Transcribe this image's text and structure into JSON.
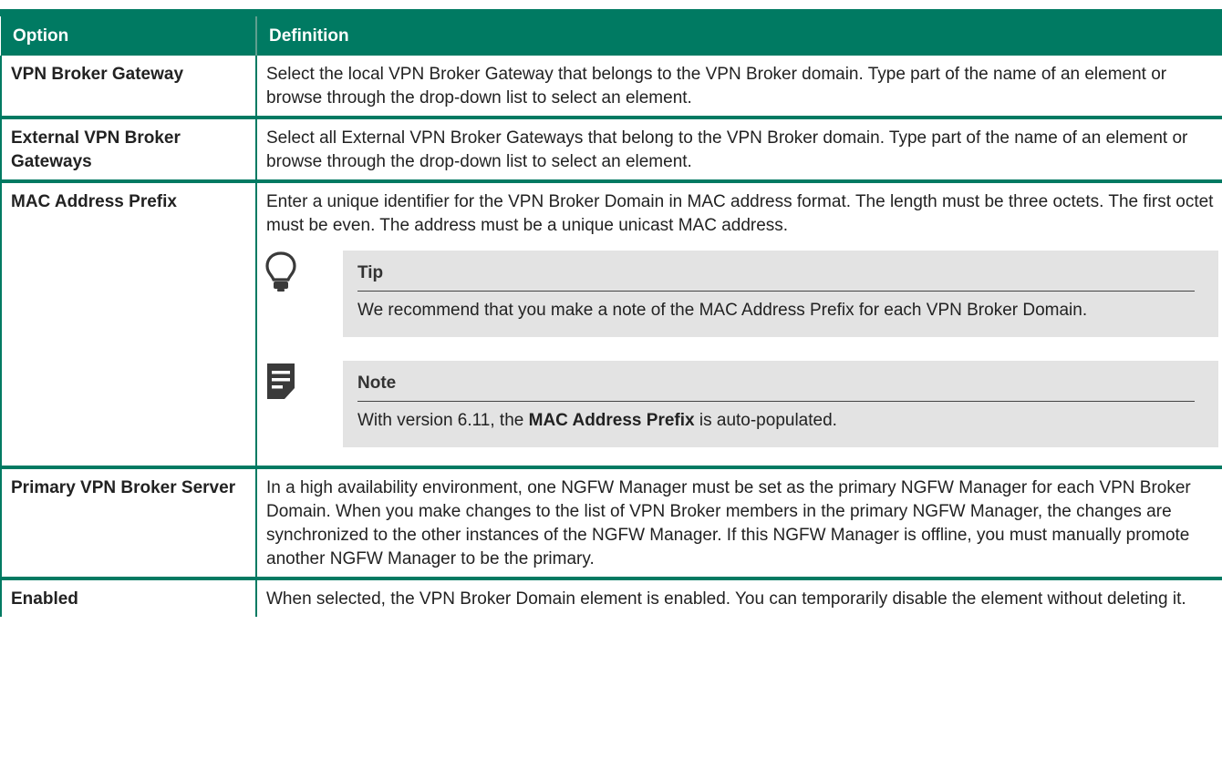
{
  "table": {
    "header": {
      "option": "Option",
      "definition": "Definition"
    },
    "rows": [
      {
        "option": "VPN Broker Gateway",
        "definition": "Select the local VPN Broker Gateway that belongs to the VPN Broker domain. Type part of the name of an element or browse through the drop-down list to select an element."
      },
      {
        "option": "External VPN Broker Gateways",
        "definition": "Select all External VPN Broker Gateways that belong to the VPN Broker domain. Type part of the name of an element or browse through the drop-down list to select an element."
      },
      {
        "option": "MAC Address Prefix",
        "definition": "Enter a unique identifier for the VPN Broker Domain in MAC address format. The length must be three octets. The first octet must be even. The address must be a unique unicast MAC address.",
        "tip": {
          "icon": "lightbulb-icon",
          "title": "Tip",
          "text": "We recommend that you make a note of the MAC Address Prefix for each VPN Broker Domain."
        },
        "note": {
          "icon": "note-icon",
          "title": "Note",
          "text_before": "With version 6.11, the ",
          "text_bold": "MAC Address Prefix",
          "text_after": " is auto-populated."
        }
      },
      {
        "option": "Primary VPN Broker Server",
        "definition": "In a high availability environment, one NGFW Manager must be set as the primary NGFW Manager for each VPN Broker Domain. When you make changes to the list of VPN Broker members in the primary NGFW Manager, the changes are synchronized to the other instances of the NGFW Manager. If this NGFW Manager is offline, you must manually promote another NGFW Manager to be the primary."
      },
      {
        "option": "Enabled",
        "definition": "When selected, the VPN Broker Domain element is enabled. You can temporarily disable the element without deleting it."
      }
    ]
  },
  "colors": {
    "header_bg": "#007a62",
    "header_text": "#ffffff",
    "callout_bg": "#e3e3e3"
  }
}
